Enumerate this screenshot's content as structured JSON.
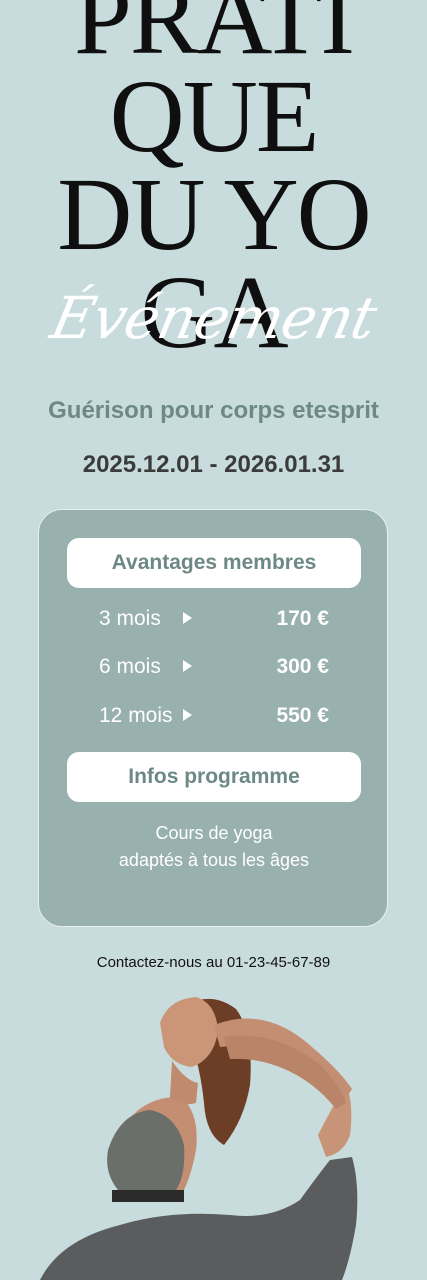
{
  "title": {
    "lines": [
      "PRATI",
      "QUE",
      "DU YO",
      "GA"
    ],
    "script": "Événement"
  },
  "subtitle": "Guérison pour corps etesprit",
  "dates": "2025.12.01 - 2026.01.31",
  "card": {
    "members_label": "Avantages membres",
    "plans": [
      {
        "duration": "3 mois",
        "price": "170 €"
      },
      {
        "duration": "6 mois",
        "price": "300 €"
      },
      {
        "duration": "12 mois",
        "price": "550 €"
      }
    ],
    "infos_label": "Infos programme",
    "description_line1": "Cours de yoga",
    "description_line2": "adaptés à tous les âges"
  },
  "contact": "Contactez-nous au 01-23-45-67-89",
  "colors": {
    "background": "#c9dcdd",
    "card": "#98b0ae",
    "accent_text": "#6d8985"
  },
  "image": "yoga-woman-pose"
}
